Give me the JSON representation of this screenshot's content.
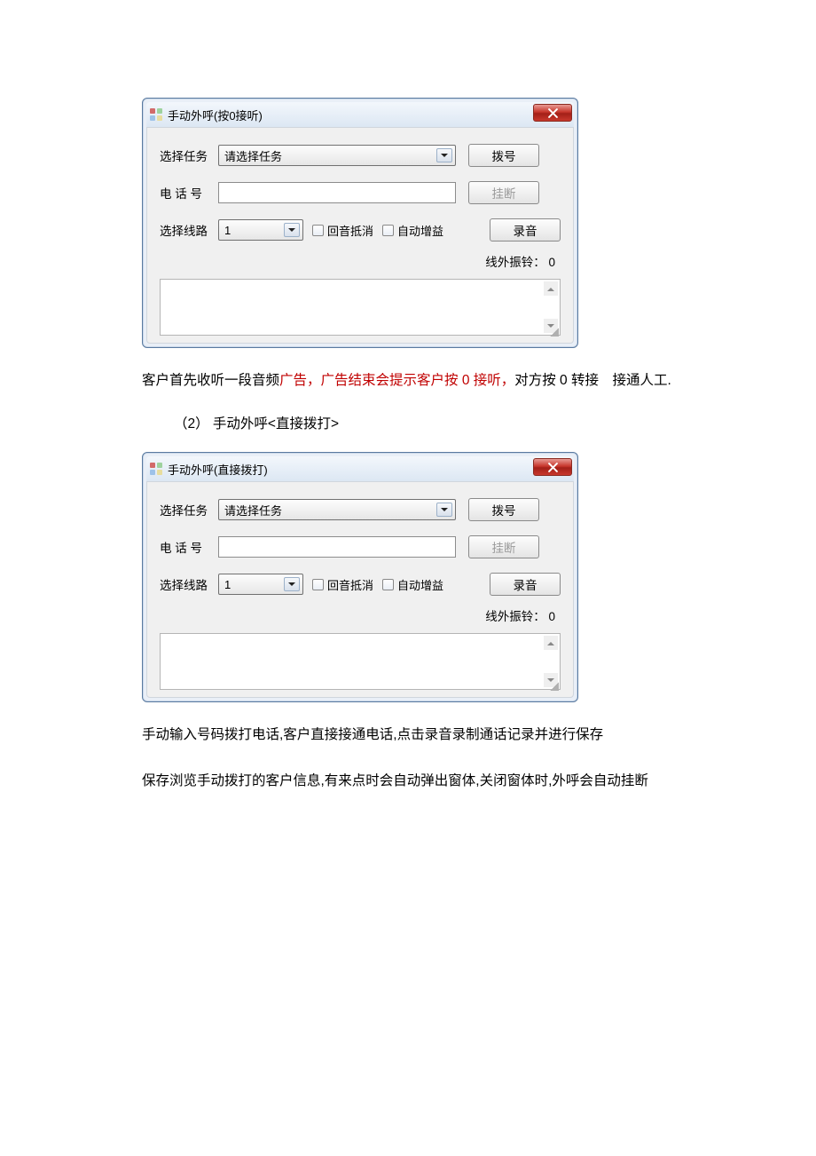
{
  "dialog1": {
    "title": "手动外呼(按0接听)",
    "labels": {
      "task": "选择任务",
      "phone": "电 话 号",
      "line": "选择线路",
      "echo": "回音抵消",
      "gain": "自动增益"
    },
    "values": {
      "task_placeholder": "请选择任务",
      "line_value": "1"
    },
    "buttons": {
      "dial": "拨号",
      "hangup": "挂断",
      "record": "录音"
    },
    "status": {
      "ring_label": "线外振铃：",
      "ring_value": "0"
    }
  },
  "para1": {
    "pre": "客户首先收听一段音频",
    "red": "广告，广告结束会提示客户按 0 接听，",
    "post": "对方按 0 转接　接通人工."
  },
  "heading2": "（2） 手动外呼<直接拨打>",
  "dialog2": {
    "title": "手动外呼(直接拨打)",
    "labels": {
      "task": "选择任务",
      "phone": "电 话 号",
      "line": "选择线路",
      "echo": "回音抵消",
      "gain": "自动增益"
    },
    "values": {
      "task_placeholder": "请选择任务",
      "line_value": "1"
    },
    "buttons": {
      "dial": "拨号",
      "hangup": "挂断",
      "record": "录音"
    },
    "status": {
      "ring_label": "线外振铃：",
      "ring_value": "0"
    }
  },
  "para2": "手动输入号码拨打电话,客户直接接通电话,点击录音录制通话记录并进行保存",
  "para3": "保存浏览手动拨打的客户信息,有来点时会自动弹出窗体,关闭窗体时,外呼会自动挂断"
}
